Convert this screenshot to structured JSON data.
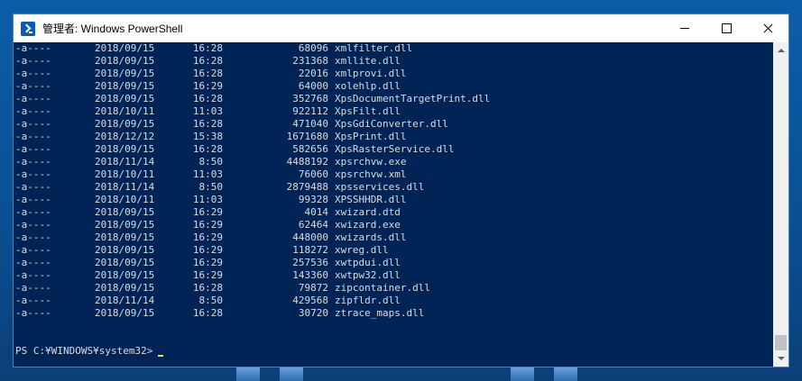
{
  "window": {
    "title": "管理者: Windows PowerShell",
    "minimize_icon": "minimize-icon",
    "maximize_icon": "maximize-icon",
    "close_icon": "close-icon"
  },
  "listing": [
    {
      "mode": "-a----",
      "date": "2018/09/15",
      "time": "16:28",
      "length": "68096",
      "name": "xmlfilter.dll"
    },
    {
      "mode": "-a----",
      "date": "2018/09/15",
      "time": "16:28",
      "length": "231368",
      "name": "xmllite.dll"
    },
    {
      "mode": "-a----",
      "date": "2018/09/15",
      "time": "16:28",
      "length": "22016",
      "name": "xmlprovi.dll"
    },
    {
      "mode": "-a----",
      "date": "2018/09/15",
      "time": "16:29",
      "length": "64000",
      "name": "xolehlp.dll"
    },
    {
      "mode": "-a----",
      "date": "2018/09/15",
      "time": "16:28",
      "length": "352768",
      "name": "XpsDocumentTargetPrint.dll"
    },
    {
      "mode": "-a----",
      "date": "2018/10/11",
      "time": "11:03",
      "length": "922112",
      "name": "XpsFilt.dll"
    },
    {
      "mode": "-a----",
      "date": "2018/09/15",
      "time": "16:28",
      "length": "471040",
      "name": "XpsGdiConverter.dll"
    },
    {
      "mode": "-a----",
      "date": "2018/12/12",
      "time": "15:38",
      "length": "1671680",
      "name": "XpsPrint.dll"
    },
    {
      "mode": "-a----",
      "date": "2018/09/15",
      "time": "16:28",
      "length": "582656",
      "name": "XpsRasterService.dll"
    },
    {
      "mode": "-a----",
      "date": "2018/11/14",
      "time": "8:50",
      "length": "4488192",
      "name": "xpsrchvw.exe"
    },
    {
      "mode": "-a----",
      "date": "2018/10/11",
      "time": "11:03",
      "length": "76060",
      "name": "xpsrchvw.xml"
    },
    {
      "mode": "-a----",
      "date": "2018/11/14",
      "time": "8:50",
      "length": "2879488",
      "name": "xpsservices.dll"
    },
    {
      "mode": "-a----",
      "date": "2018/10/11",
      "time": "11:03",
      "length": "99328",
      "name": "XPSSHHDR.dll"
    },
    {
      "mode": "-a----",
      "date": "2018/09/15",
      "time": "16:29",
      "length": "4014",
      "name": "xwizard.dtd"
    },
    {
      "mode": "-a----",
      "date": "2018/09/15",
      "time": "16:29",
      "length": "62464",
      "name": "xwizard.exe"
    },
    {
      "mode": "-a----",
      "date": "2018/09/15",
      "time": "16:29",
      "length": "448000",
      "name": "xwizards.dll"
    },
    {
      "mode": "-a----",
      "date": "2018/09/15",
      "time": "16:29",
      "length": "118272",
      "name": "xwreg.dll"
    },
    {
      "mode": "-a----",
      "date": "2018/09/15",
      "time": "16:29",
      "length": "257536",
      "name": "xwtpdui.dll"
    },
    {
      "mode": "-a----",
      "date": "2018/09/15",
      "time": "16:29",
      "length": "143360",
      "name": "xwtpw32.dll"
    },
    {
      "mode": "-a----",
      "date": "2018/09/15",
      "time": "16:28",
      "length": "79872",
      "name": "zipcontainer.dll"
    },
    {
      "mode": "-a----",
      "date": "2018/11/14",
      "time": "8:50",
      "length": "429568",
      "name": "zipfldr.dll"
    },
    {
      "mode": "-a----",
      "date": "2018/09/15",
      "time": "16:28",
      "length": "30720",
      "name": "ztrace_maps.dll"
    }
  ],
  "prompt": {
    "text": "PS C:¥WINDOWS¥system32>"
  },
  "colors": {
    "console_bg": "#012456",
    "console_fg": "#dcdcdc"
  }
}
